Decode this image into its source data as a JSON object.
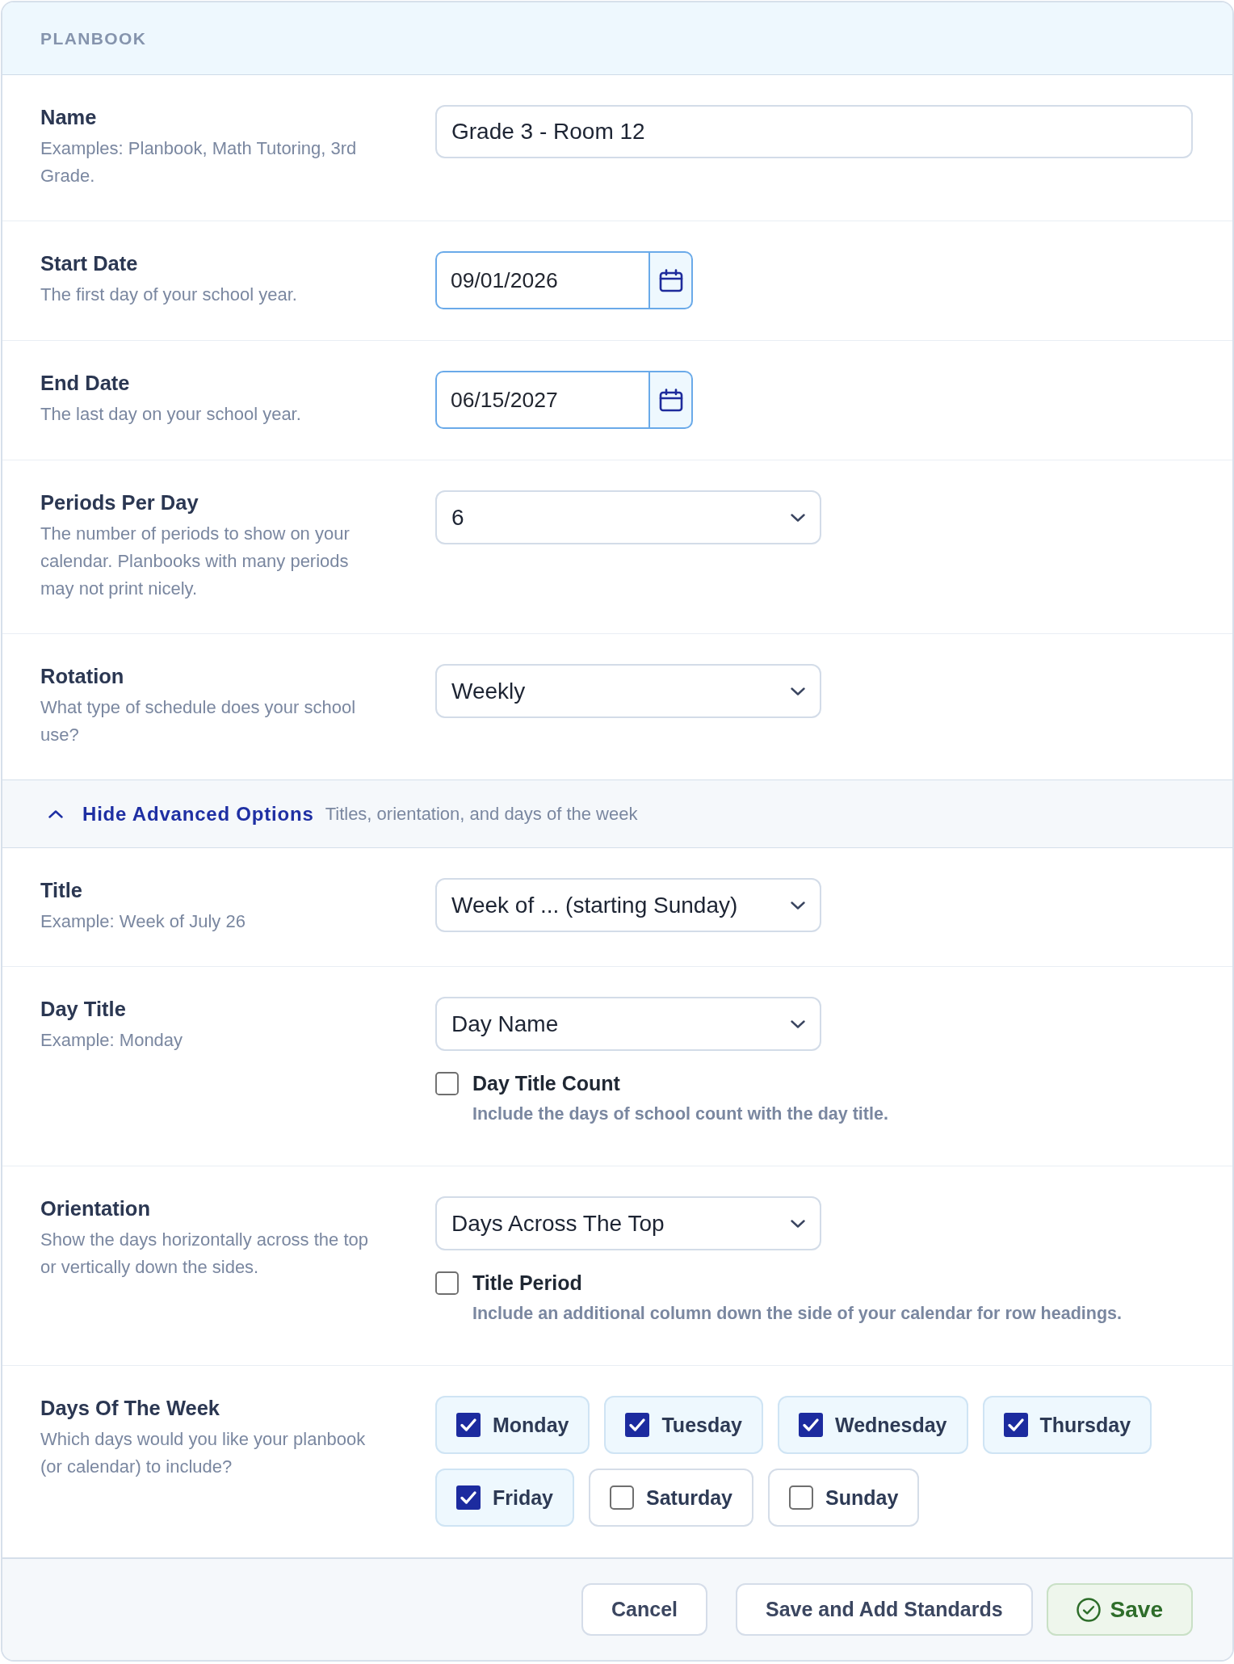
{
  "header": {
    "title": "PLANBOOK"
  },
  "fields": [
    {
      "kind": "text",
      "label": "Name",
      "description": "Examples: Planbook, Math Tutoring, 3rd Grade.",
      "value": "Grade 3 - Room 12"
    },
    {
      "kind": "date",
      "label": "Start Date",
      "description": "The first day of your school year.",
      "value": "09/01/2026"
    },
    {
      "kind": "date",
      "label": "End Date",
      "description": "The last day on your school year.",
      "value": "06/15/2027"
    },
    {
      "kind": "select",
      "label": "Periods Per Day",
      "description": "The number of periods to show on your calendar. Planbooks with many periods may not print nicely.",
      "value": "6"
    },
    {
      "kind": "select",
      "label": "Rotation",
      "description": "What type of schedule does your school use?",
      "value": "Weekly"
    }
  ],
  "advanced_toggle": {
    "label": "Hide Advanced Options",
    "description": "Titles, orientation, and days of the week",
    "expanded": true
  },
  "advanced_fields": [
    {
      "kind": "select",
      "label": "Title",
      "description": "Example: Week of July 26",
      "value": "Week of ... (starting Sunday)"
    },
    {
      "kind": "select",
      "label": "Day Title",
      "description": "Example: Monday",
      "value": "Day Name",
      "option": {
        "label": "Day Title Count",
        "description": "Include the days of school count with the day title.",
        "checked": false
      }
    },
    {
      "kind": "select",
      "label": "Orientation",
      "description": "Show the days horizontally across the top or vertically down the sides.",
      "value": "Days Across The Top",
      "option": {
        "label": "Title Period",
        "description": "Include an additional column down the side of your calendar for row headings.",
        "checked": false
      }
    },
    {
      "kind": "days",
      "label": "Days Of The Week",
      "description": "Which days would you like your planbook (or calendar) to include?",
      "days": [
        {
          "label": "Monday",
          "checked": true
        },
        {
          "label": "Tuesday",
          "checked": true
        },
        {
          "label": "Wednesday",
          "checked": true
        },
        {
          "label": "Thursday",
          "checked": true
        },
        {
          "label": "Friday",
          "checked": true
        },
        {
          "label": "Saturday",
          "checked": false
        },
        {
          "label": "Sunday",
          "checked": false
        }
      ]
    }
  ],
  "footer": {
    "buttons": [
      {
        "label": "Cancel",
        "kind": "cancel"
      },
      {
        "label": "Save and Add Standards",
        "kind": "secondary"
      },
      {
        "label": "Save",
        "kind": "primary"
      }
    ]
  }
}
